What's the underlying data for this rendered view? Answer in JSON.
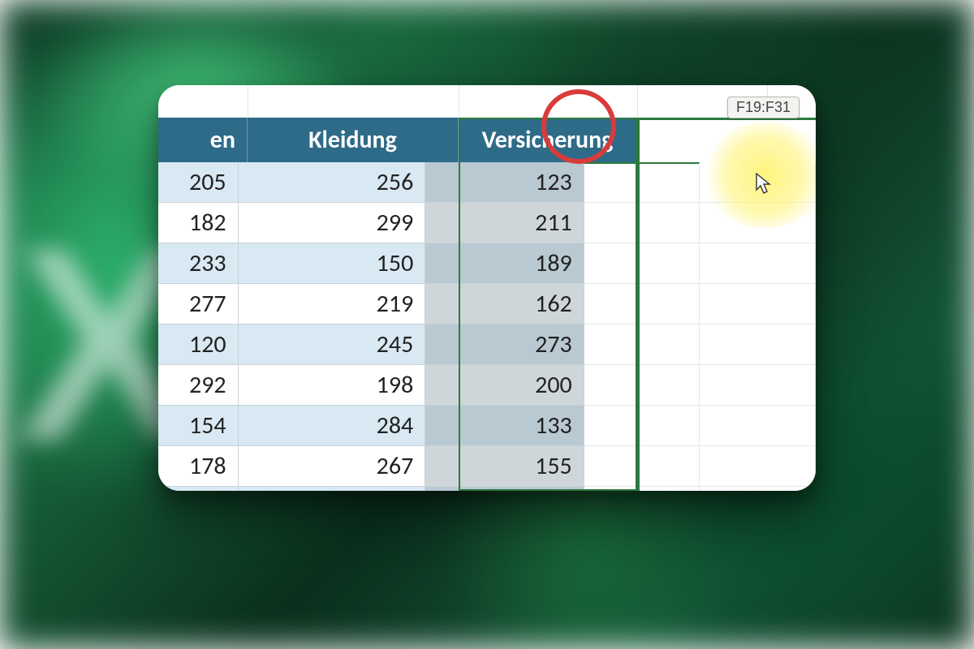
{
  "selection": {
    "range_tooltip": "F19:F31"
  },
  "table": {
    "headers": {
      "col_a_fragment": "en",
      "col_b": "Kleidung",
      "col_c": "Versicherung"
    },
    "rows": [
      {
        "a": "205",
        "b": "256",
        "c": "123"
      },
      {
        "a": "182",
        "b": "299",
        "c": "211"
      },
      {
        "a": "233",
        "b": "150",
        "c": "189"
      },
      {
        "a": "277",
        "b": "219",
        "c": "162"
      },
      {
        "a": "120",
        "b": "245",
        "c": "273"
      },
      {
        "a": "292",
        "b": "198",
        "c": "200"
      },
      {
        "a": "154",
        "b": "284",
        "c": "133"
      },
      {
        "a": "178",
        "b": "267",
        "c": "155"
      }
    ]
  },
  "colors": {
    "header_bg": "#2e6b88",
    "row_even": "#d8e9f3",
    "row_odd": "#ffffff",
    "selected_even": "#b9c9d2",
    "selected_odd": "#cfd6da",
    "selection_border": "#2c7a3f",
    "annotation_red": "#d93b3b",
    "highlight_yellow": "#fff478"
  }
}
